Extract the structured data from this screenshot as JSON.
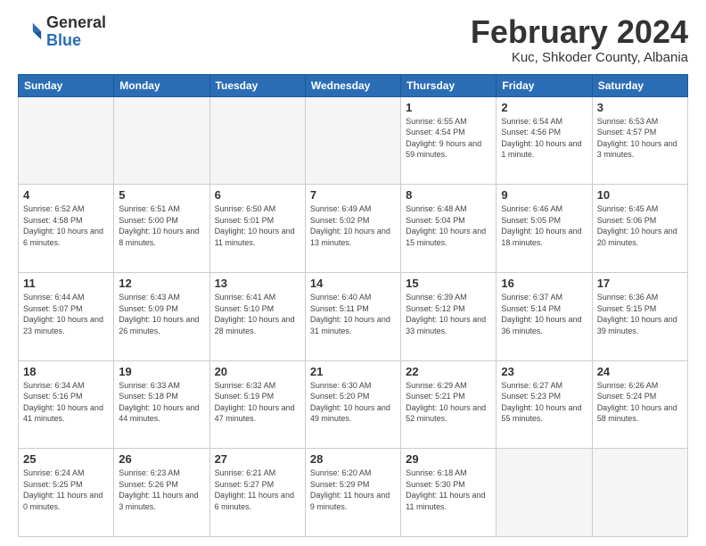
{
  "logo": {
    "general": "General",
    "blue": "Blue"
  },
  "header": {
    "title": "February 2024",
    "subtitle": "Kuc, Shkoder County, Albania"
  },
  "weekdays": [
    "Sunday",
    "Monday",
    "Tuesday",
    "Wednesday",
    "Thursday",
    "Friday",
    "Saturday"
  ],
  "weeks": [
    [
      {
        "day": "",
        "empty": true
      },
      {
        "day": "",
        "empty": true
      },
      {
        "day": "",
        "empty": true
      },
      {
        "day": "",
        "empty": true
      },
      {
        "day": "1",
        "sunrise": "6:55 AM",
        "sunset": "4:54 PM",
        "daylight": "9 hours and 59 minutes."
      },
      {
        "day": "2",
        "sunrise": "6:54 AM",
        "sunset": "4:56 PM",
        "daylight": "10 hours and 1 minute."
      },
      {
        "day": "3",
        "sunrise": "6:53 AM",
        "sunset": "4:57 PM",
        "daylight": "10 hours and 3 minutes."
      }
    ],
    [
      {
        "day": "4",
        "sunrise": "6:52 AM",
        "sunset": "4:58 PM",
        "daylight": "10 hours and 6 minutes."
      },
      {
        "day": "5",
        "sunrise": "6:51 AM",
        "sunset": "5:00 PM",
        "daylight": "10 hours and 8 minutes."
      },
      {
        "day": "6",
        "sunrise": "6:50 AM",
        "sunset": "5:01 PM",
        "daylight": "10 hours and 11 minutes."
      },
      {
        "day": "7",
        "sunrise": "6:49 AM",
        "sunset": "5:02 PM",
        "daylight": "10 hours and 13 minutes."
      },
      {
        "day": "8",
        "sunrise": "6:48 AM",
        "sunset": "5:04 PM",
        "daylight": "10 hours and 15 minutes."
      },
      {
        "day": "9",
        "sunrise": "6:46 AM",
        "sunset": "5:05 PM",
        "daylight": "10 hours and 18 minutes."
      },
      {
        "day": "10",
        "sunrise": "6:45 AM",
        "sunset": "5:06 PM",
        "daylight": "10 hours and 20 minutes."
      }
    ],
    [
      {
        "day": "11",
        "sunrise": "6:44 AM",
        "sunset": "5:07 PM",
        "daylight": "10 hours and 23 minutes."
      },
      {
        "day": "12",
        "sunrise": "6:43 AM",
        "sunset": "5:09 PM",
        "daylight": "10 hours and 26 minutes."
      },
      {
        "day": "13",
        "sunrise": "6:41 AM",
        "sunset": "5:10 PM",
        "daylight": "10 hours and 28 minutes."
      },
      {
        "day": "14",
        "sunrise": "6:40 AM",
        "sunset": "5:11 PM",
        "daylight": "10 hours and 31 minutes."
      },
      {
        "day": "15",
        "sunrise": "6:39 AM",
        "sunset": "5:12 PM",
        "daylight": "10 hours and 33 minutes."
      },
      {
        "day": "16",
        "sunrise": "6:37 AM",
        "sunset": "5:14 PM",
        "daylight": "10 hours and 36 minutes."
      },
      {
        "day": "17",
        "sunrise": "6:36 AM",
        "sunset": "5:15 PM",
        "daylight": "10 hours and 39 minutes."
      }
    ],
    [
      {
        "day": "18",
        "sunrise": "6:34 AM",
        "sunset": "5:16 PM",
        "daylight": "10 hours and 41 minutes."
      },
      {
        "day": "19",
        "sunrise": "6:33 AM",
        "sunset": "5:18 PM",
        "daylight": "10 hours and 44 minutes."
      },
      {
        "day": "20",
        "sunrise": "6:32 AM",
        "sunset": "5:19 PM",
        "daylight": "10 hours and 47 minutes."
      },
      {
        "day": "21",
        "sunrise": "6:30 AM",
        "sunset": "5:20 PM",
        "daylight": "10 hours and 49 minutes."
      },
      {
        "day": "22",
        "sunrise": "6:29 AM",
        "sunset": "5:21 PM",
        "daylight": "10 hours and 52 minutes."
      },
      {
        "day": "23",
        "sunrise": "6:27 AM",
        "sunset": "5:23 PM",
        "daylight": "10 hours and 55 minutes."
      },
      {
        "day": "24",
        "sunrise": "6:26 AM",
        "sunset": "5:24 PM",
        "daylight": "10 hours and 58 minutes."
      }
    ],
    [
      {
        "day": "25",
        "sunrise": "6:24 AM",
        "sunset": "5:25 PM",
        "daylight": "11 hours and 0 minutes."
      },
      {
        "day": "26",
        "sunrise": "6:23 AM",
        "sunset": "5:26 PM",
        "daylight": "11 hours and 3 minutes."
      },
      {
        "day": "27",
        "sunrise": "6:21 AM",
        "sunset": "5:27 PM",
        "daylight": "11 hours and 6 minutes."
      },
      {
        "day": "28",
        "sunrise": "6:20 AM",
        "sunset": "5:29 PM",
        "daylight": "11 hours and 9 minutes."
      },
      {
        "day": "29",
        "sunrise": "6:18 AM",
        "sunset": "5:30 PM",
        "daylight": "11 hours and 11 minutes."
      },
      {
        "day": "",
        "empty": true
      },
      {
        "day": "",
        "empty": true
      }
    ]
  ]
}
